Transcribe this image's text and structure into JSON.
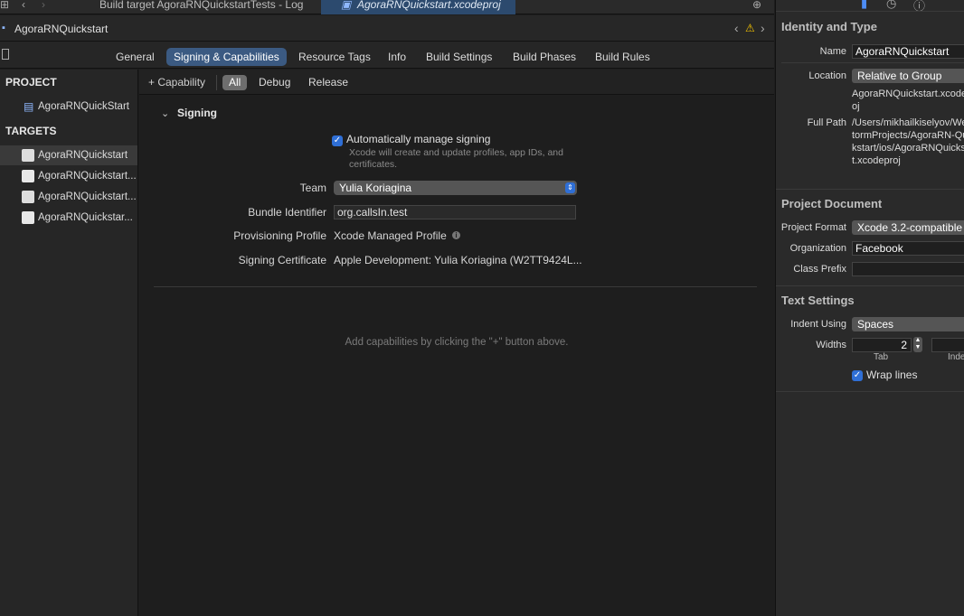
{
  "tabs": [
    {
      "label": "Build target AgoraRNQuickstartTests - Log"
    },
    {
      "label": "AgoraRNQuickstart.xcodeproj"
    }
  ],
  "jumpbar": {
    "title": "AgoraRNQuickstart"
  },
  "editor_tabs": [
    {
      "label": "General"
    },
    {
      "label": "Signing & Capabilities"
    },
    {
      "label": "Resource Tags"
    },
    {
      "label": "Info"
    },
    {
      "label": "Build Settings"
    },
    {
      "label": "Build Phases"
    },
    {
      "label": "Build Rules"
    }
  ],
  "navigator": {
    "project_header": "PROJECT",
    "project_item": "AgoraRNQuickStart",
    "targets_header": "TARGETS",
    "targets": [
      {
        "label": "AgoraRNQuickstart"
      },
      {
        "label": "AgoraRNQuickstart..."
      },
      {
        "label": "AgoraRNQuickstart..."
      },
      {
        "label": "AgoraRNQuickstar..."
      }
    ]
  },
  "config": {
    "add_capability": "+ Capability",
    "segments": [
      "All",
      "Debug",
      "Release"
    ]
  },
  "signing": {
    "section_title": "Signing",
    "auto_manage_label": "Automatically manage signing",
    "auto_manage_hint": "Xcode will create and update profiles, app IDs, and certificates.",
    "team_label": "Team",
    "team_value": "Yulia Koriagina",
    "bundle_label": "Bundle Identifier",
    "bundle_value": "org.callsIn.test",
    "profile_label": "Provisioning Profile",
    "profile_value": "Xcode Managed Profile",
    "cert_label": "Signing Certificate",
    "cert_value": "Apple Development: Yulia Koriagina (W2TT9424L..."
  },
  "empty_hint": "Add capabilities by clicking the \"+\" button above.",
  "inspector": {
    "identity_title": "Identity and Type",
    "name_label": "Name",
    "name_value": "AgoraRNQuickstart",
    "location_label": "Location",
    "location_value": "Relative to Group",
    "location_file": "AgoraRNQuickstart.xcodeproj",
    "fullpath_label": "Full Path",
    "fullpath_value": "/Users/mikhailkiselyov/WebstormProjects/AgoraRN-Quickstart/ios/AgoraRNQuickstart.xcodeproj",
    "project_doc_title": "Project Document",
    "format_label": "Project Format",
    "format_value": "Xcode 3.2-compatible",
    "org_label": "Organization",
    "org_value": "Facebook",
    "class_prefix_label": "Class Prefix",
    "class_prefix_value": "",
    "text_settings_title": "Text Settings",
    "indent_label": "Indent Using",
    "indent_value": "Spaces",
    "widths_label": "Widths",
    "tab_width": "2",
    "tab_caption": "Tab",
    "indent_caption": "Inde",
    "wrap_label": "Wrap lines"
  }
}
